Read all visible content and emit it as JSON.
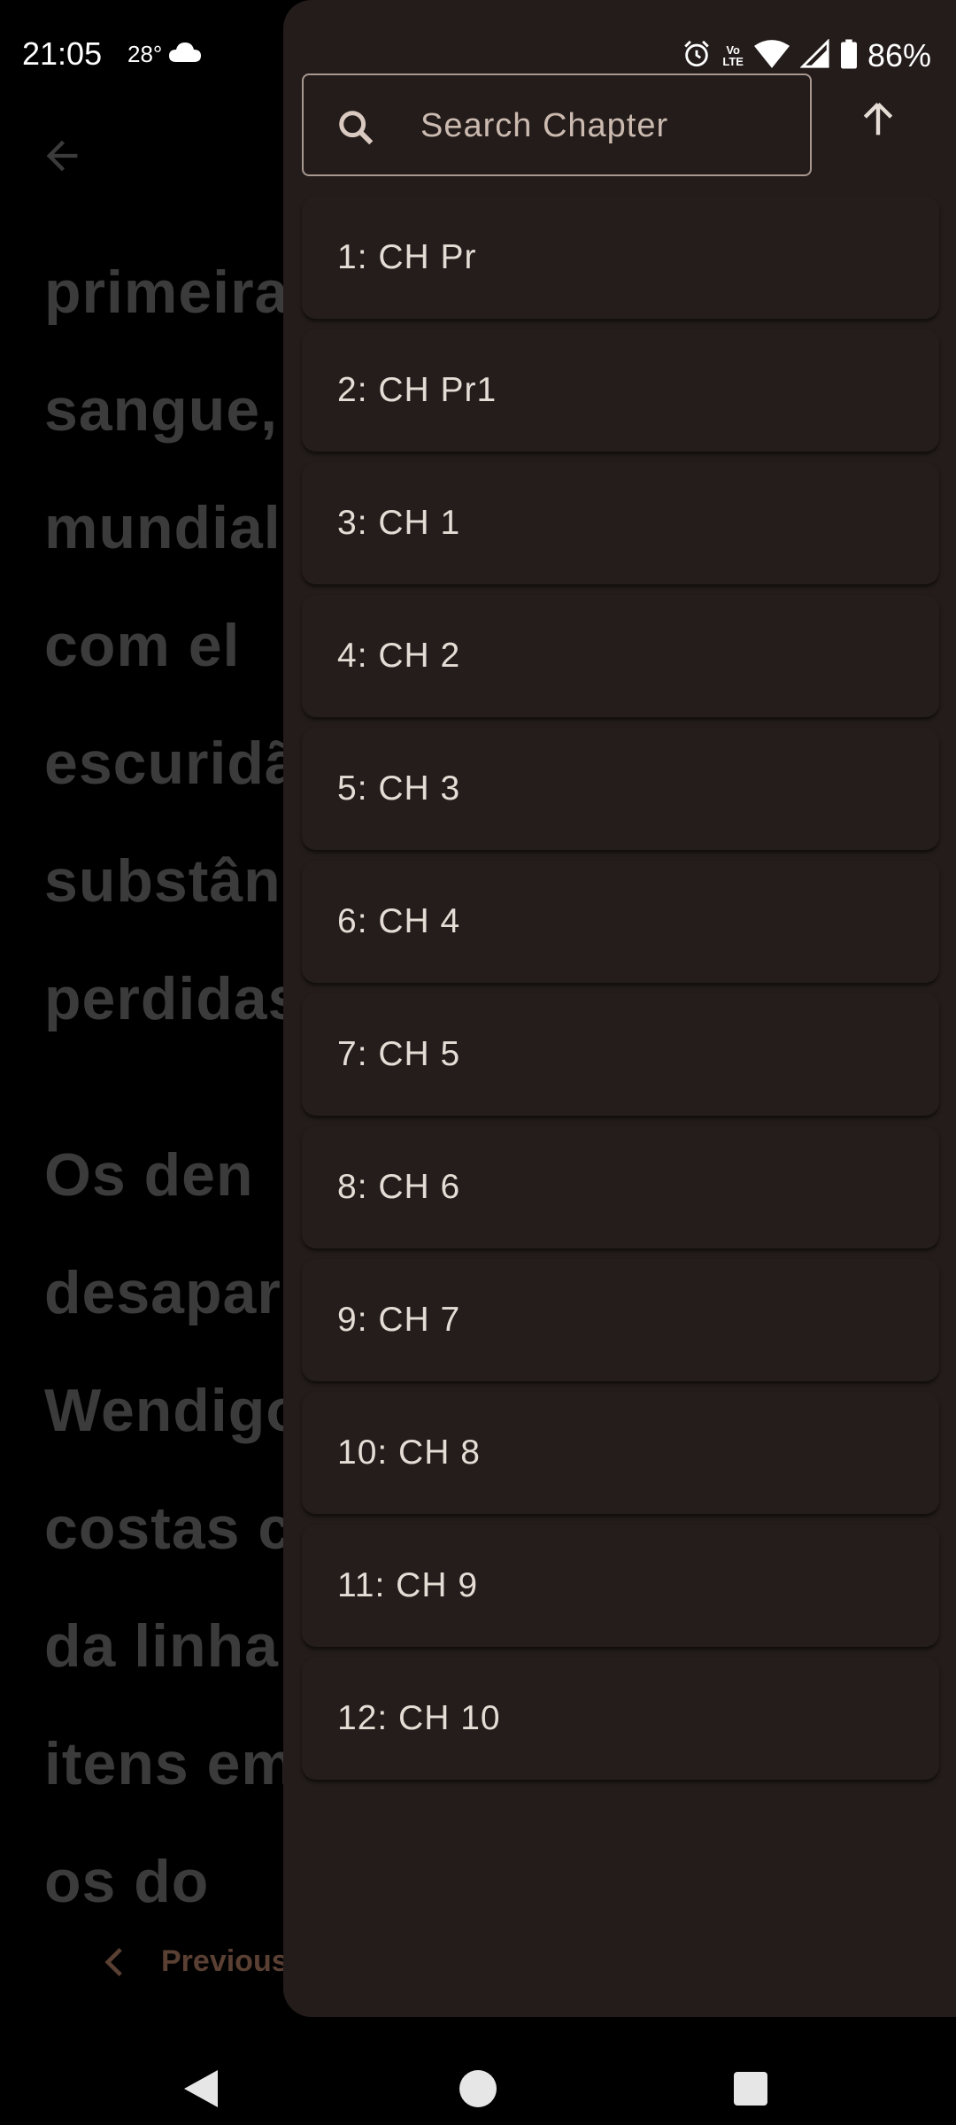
{
  "status_bar": {
    "time": "21:05",
    "temperature": "28°",
    "battery": "86%",
    "volte_top": "Vo",
    "volte_bottom": "LTE"
  },
  "reader": {
    "lines": [
      "primeira",
      "sangue,",
      "mundial",
      "com    el",
      "escuridã",
      "substânc",
      "perdidas",
      "",
      "Os    den",
      "desapar",
      "Wendigo",
      "costas c",
      "da  linha",
      "itens  em",
      "os      do"
    ],
    "previous_label": "Previous"
  },
  "drawer": {
    "search_placeholder": "Search Chapter",
    "chapters": [
      "1: CH Pr",
      "2: CH Pr1",
      "3: CH 1",
      "4: CH 2",
      "5: CH 3",
      "6: CH 4",
      "7: CH 5",
      "8: CH 6",
      "9: CH 7",
      "10: CH 8",
      "11: CH 9",
      "12: CH 10"
    ]
  },
  "colors": {
    "drawer_bg": "#231c1a",
    "chapter_text": "#e6dcd6",
    "reader_text": "#3b3b3b",
    "accent": "#5a3f33"
  }
}
